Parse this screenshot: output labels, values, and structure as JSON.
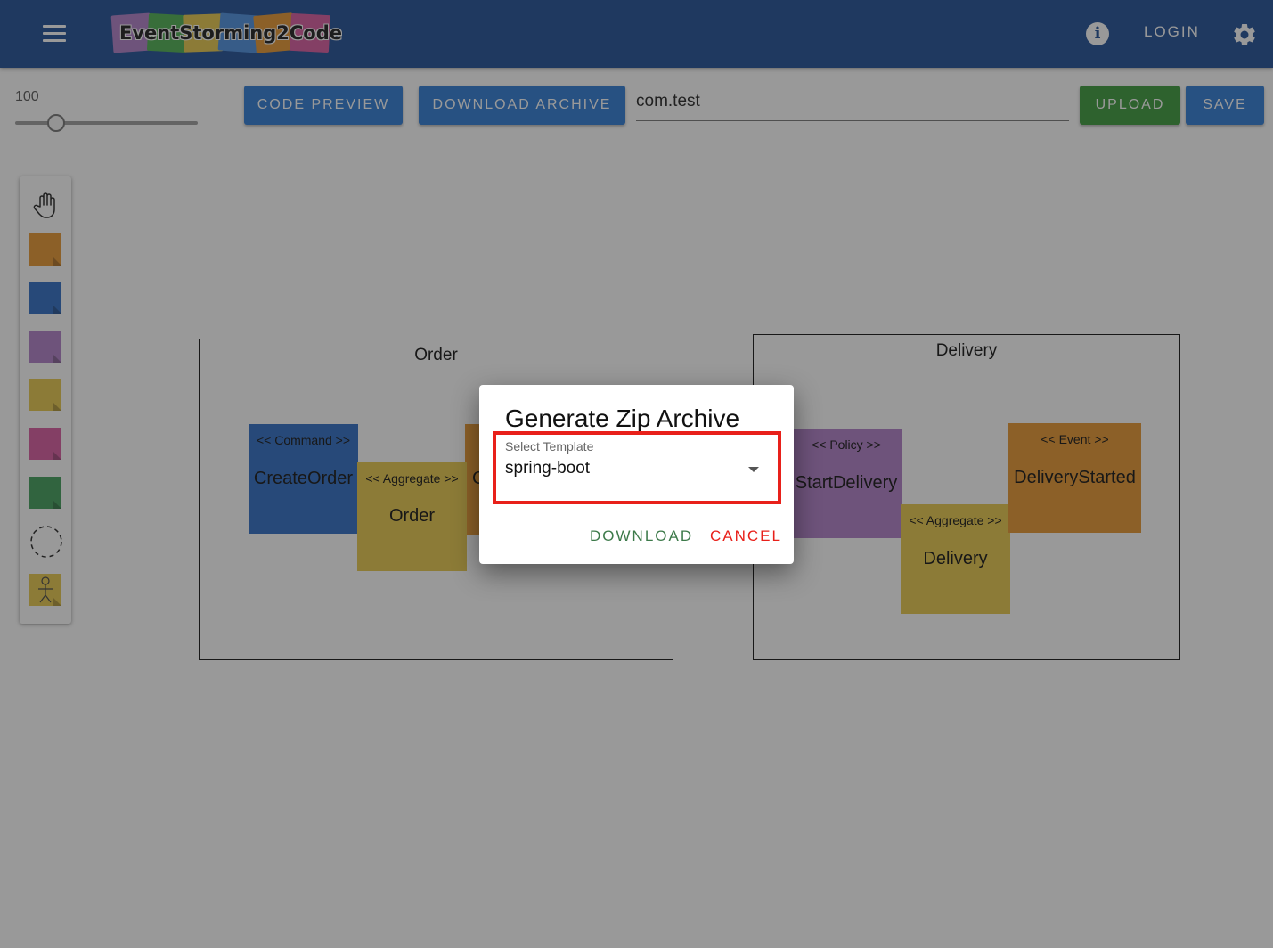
{
  "appbar": {
    "logo_text": "EventStorming2Code",
    "login_label": "LOGIN",
    "brand_color": "#1f4e96"
  },
  "toolbar": {
    "zoom_value": "100",
    "code_preview_label": "CODE PREVIEW",
    "download_archive_label": "DOWNLOAD ARCHIVE",
    "package_name": "com.test",
    "upload_label": "UPLOAD",
    "save_label": "SAVE",
    "zoom_level": 100
  },
  "palette": {
    "tools": [
      "hand-tool",
      "event-sticker",
      "command-sticker",
      "policy-sticker",
      "aggregate-sticker",
      "external-sticker",
      "view-sticker",
      "bounded-context-tool",
      "actor-sticker"
    ]
  },
  "canvas": {
    "contexts": [
      {
        "title": "Order",
        "stickers": [
          {
            "stereotype": "<< Command >>",
            "name": "CreateOrder",
            "color": "#2e6cc4"
          },
          {
            "stereotype": "<< Aggregate >>",
            "name": "Order",
            "color": "#e8c74a"
          },
          {
            "stereotype": "",
            "name": "C",
            "color": "#e8962f"
          }
        ]
      },
      {
        "title": "Delivery",
        "stickers": [
          {
            "stereotype": "<< Policy >>",
            "name": "StartDelivery",
            "color": "#b07fc7"
          },
          {
            "stereotype": "<< Aggregate >>",
            "name": "Delivery",
            "color": "#e8c74a"
          },
          {
            "stereotype": "<< Event >>",
            "name": "DeliveryStarted",
            "color": "#e8962f"
          }
        ]
      }
    ]
  },
  "dialog": {
    "title": "Generate Zip Archive",
    "select_label": "Select Template",
    "select_value": "spring-boot",
    "download_label": "DOWNLOAD",
    "cancel_label": "CANCEL",
    "highlight_color": "#e8201a"
  }
}
